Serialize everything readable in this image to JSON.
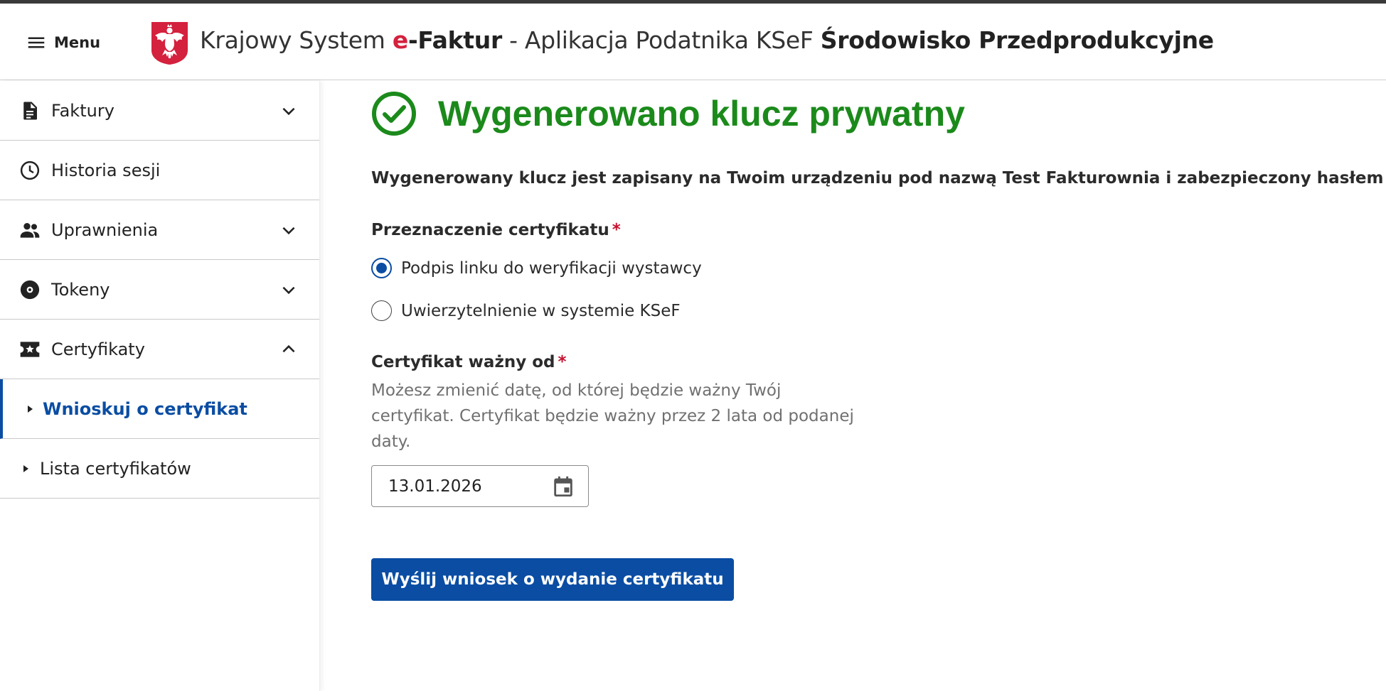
{
  "header": {
    "menu_label": "Menu",
    "title_part1": "Krajowy System ",
    "title_e": "e",
    "title_faktur": "-Faktur",
    "title_part2": " - Aplikacja Podatnika KSeF ",
    "title_env": "Środowisko Przedprodukcyjne"
  },
  "sidebar": {
    "items": [
      {
        "label": "Faktury",
        "icon": "document-icon",
        "expandable": true,
        "expanded": false
      },
      {
        "label": "Historia sesji",
        "icon": "clock-icon",
        "expandable": false
      },
      {
        "label": "Uprawnienia",
        "icon": "people-icon",
        "expandable": true,
        "expanded": false
      },
      {
        "label": "Tokeny",
        "icon": "token-icon",
        "expandable": true,
        "expanded": false
      },
      {
        "label": "Certyfikaty",
        "icon": "certificate-icon",
        "expandable": true,
        "expanded": true
      }
    ],
    "sub_items": [
      {
        "label": "Wnioskuj o certyfikat",
        "active": true
      },
      {
        "label": "Lista certyfikatów",
        "active": false
      }
    ]
  },
  "main": {
    "success_title": "Wygenerowano klucz prywatny",
    "info_text": "Wygenerowany klucz jest zapisany na Twoim urządzeniu pod nazwą Test Fakturownia i zabezpieczony hasłem",
    "purpose": {
      "label": "Przeznaczenie certyfikatu",
      "required_mark": "*",
      "options": [
        {
          "label": "Podpis linku do weryfikacji wystawcy",
          "selected": true
        },
        {
          "label": "Uwierzytelnienie w systemie KSeF",
          "selected": false
        }
      ]
    },
    "valid_from": {
      "label": "Certyfikat ważny od",
      "required_mark": "*",
      "description": "Możesz zmienić datę, od której będzie ważny Twój certyfikat. Certyfikat będzie ważny przez 2 lata od podanej daty.",
      "value": "13.01.2026"
    },
    "submit_label": "Wyślij wniosek o wydanie certyfikatu"
  },
  "colors": {
    "accent": "#0a4da3",
    "success": "#1b8a1b",
    "required": "#c8102e",
    "brand_red": "#d4213d"
  }
}
